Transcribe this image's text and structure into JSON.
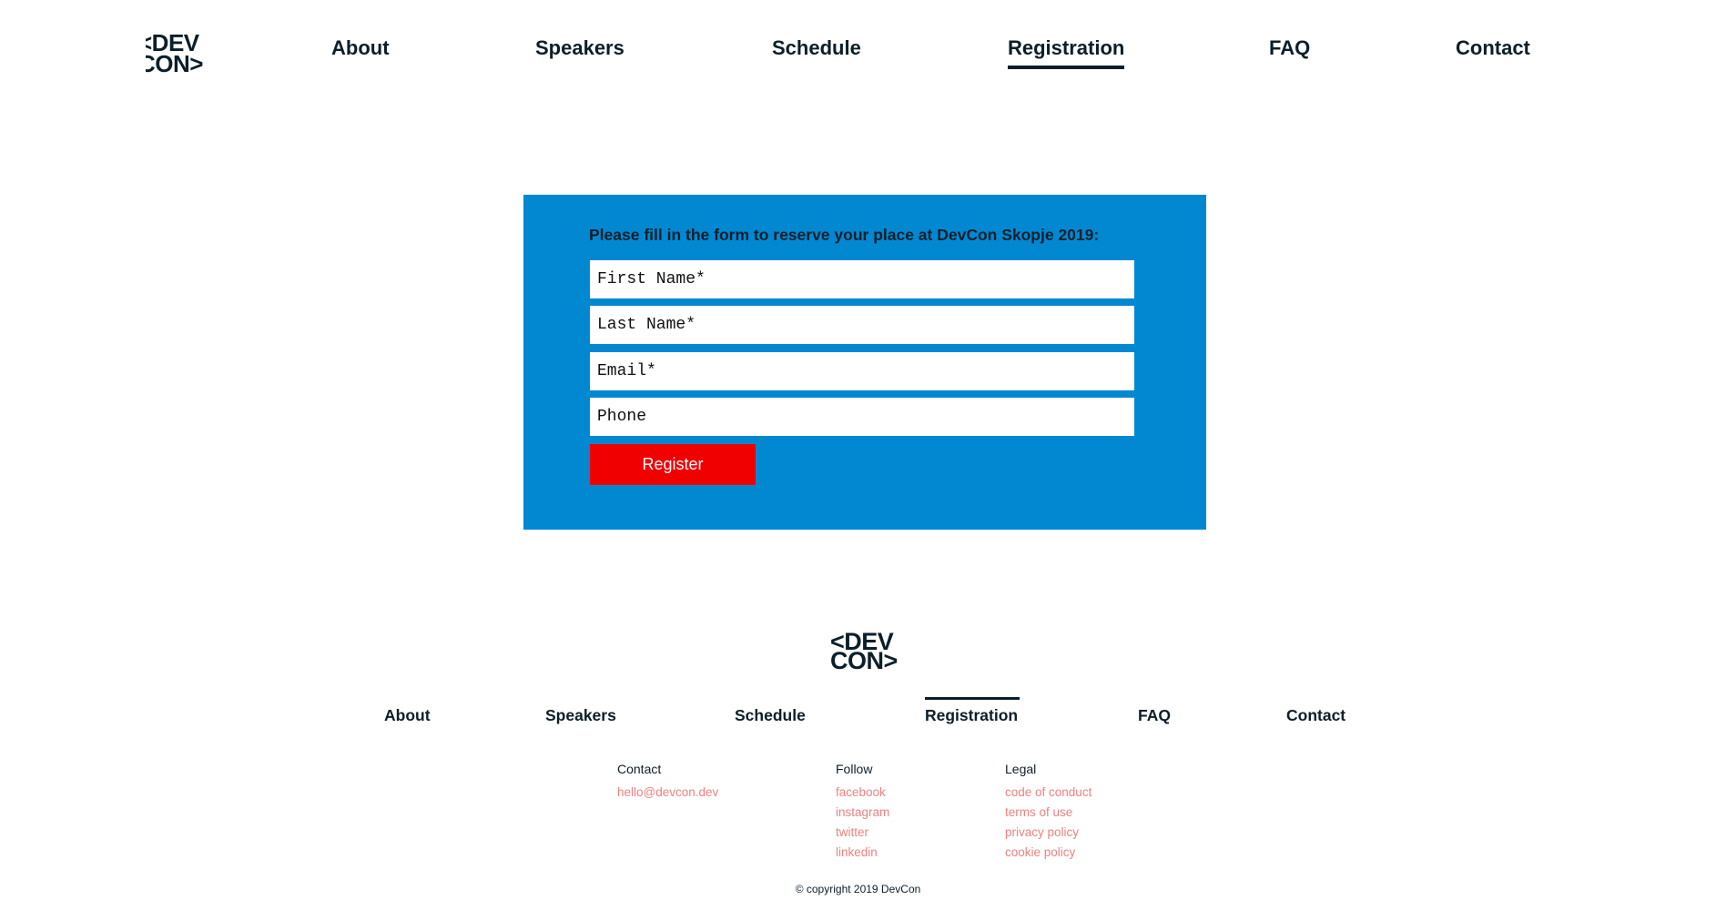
{
  "brand": {
    "logo_line1": "<DEV",
    "logo_line2": "CON>"
  },
  "nav": {
    "items": [
      "About",
      "Speakers",
      "Schedule",
      "Registration",
      "FAQ",
      "Contact"
    ],
    "active": "Registration"
  },
  "form": {
    "intro": "Please fill in the form to reserve your place at DevCon Skopje 2019:",
    "first_name_placeholder": "First Name*",
    "last_name_placeholder": "Last Name*",
    "email_placeholder": "Email*",
    "phone_placeholder": "Phone",
    "submit_label": "Register"
  },
  "footer": {
    "contact": {
      "title": "Contact",
      "email": "hello@devcon.dev"
    },
    "follow": {
      "title": "Follow",
      "links": [
        "facebook",
        "instagram",
        "twitter",
        "linkedin"
      ]
    },
    "legal": {
      "title": "Legal",
      "links": [
        "code of conduct",
        "terms of use",
        "privacy policy",
        "cookie policy"
      ]
    },
    "copyright": "© copyright 2019 DevCon"
  },
  "colors": {
    "panel_blue": "#0288d1",
    "button_red": "#f00000",
    "link_pink": "#f08080",
    "text_dark": "#0b1f2a"
  }
}
